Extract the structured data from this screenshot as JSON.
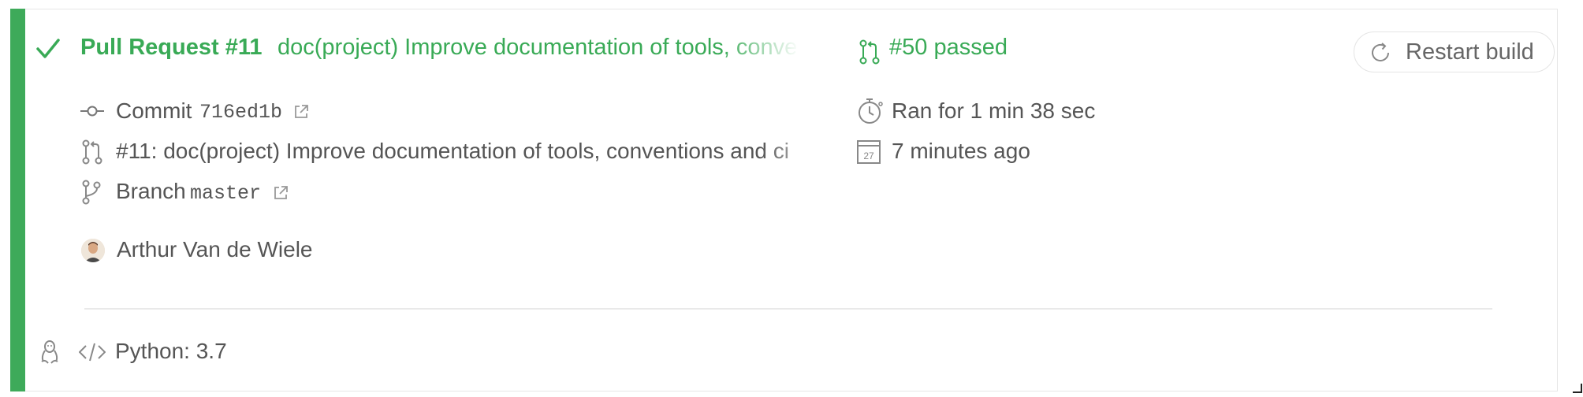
{
  "build": {
    "pr_title": "Pull Request #11",
    "pr_message": "doc(project) Improve documentation of tools, conventions and ci",
    "build_status": "#50 passed",
    "restart_label": "Restart build"
  },
  "commit": {
    "label": "Commit",
    "sha": "716ed1b"
  },
  "pull_request_line": "#11: doc(project) Improve documentation of tools, conventions and ci",
  "branch": {
    "label": "Branch",
    "name": "master"
  },
  "author": "Arthur Van de Wiele",
  "duration": "Ran for 1 min 38 sec",
  "finished": "7 minutes ago",
  "calendar_day": "27",
  "job": {
    "language": "Python: 3.7"
  },
  "colors": {
    "success": "#39aa56",
    "stripe": "#3eaa5a",
    "text": "#555555"
  },
  "icons": [
    "check-icon",
    "pull-request-icon",
    "commit-icon",
    "external-link-icon",
    "branch-icon",
    "stopwatch-icon",
    "calendar-icon",
    "restart-icon",
    "linux-icon",
    "code-icon"
  ]
}
